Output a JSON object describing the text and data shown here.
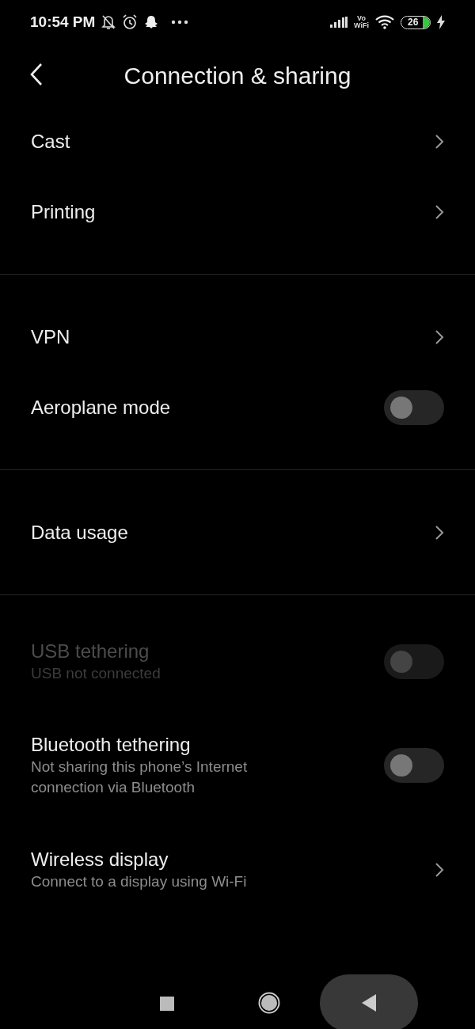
{
  "status_bar": {
    "time": "10:54 PM",
    "network_label": [
      "Vo",
      "WiFi"
    ],
    "battery": "26",
    "charging": true
  },
  "header": {
    "title": "Connection & sharing"
  },
  "sections": [
    {
      "items": [
        {
          "kind": "link",
          "title": "Cast",
          "disabled": false
        },
        {
          "kind": "link",
          "title": "Printing",
          "disabled": false
        }
      ]
    },
    {
      "items": [
        {
          "kind": "link",
          "title": "VPN",
          "disabled": false
        },
        {
          "kind": "toggle",
          "title": "Aeroplane mode",
          "on": false,
          "disabled": false
        }
      ]
    },
    {
      "items": [
        {
          "kind": "link",
          "title": "Data usage",
          "disabled": false
        }
      ]
    },
    {
      "items": [
        {
          "kind": "toggle",
          "title": "USB tethering",
          "subtitle": "USB not connected",
          "on": false,
          "disabled": true
        },
        {
          "kind": "toggle",
          "title": "Bluetooth tethering",
          "subtitle": "Not sharing this phone’s Internet connection via Bluetooth",
          "on": false,
          "disabled": false
        },
        {
          "kind": "link",
          "title": "Wireless display",
          "subtitle": "Connect to a display using Wi-Fi",
          "disabled": false
        }
      ]
    }
  ]
}
